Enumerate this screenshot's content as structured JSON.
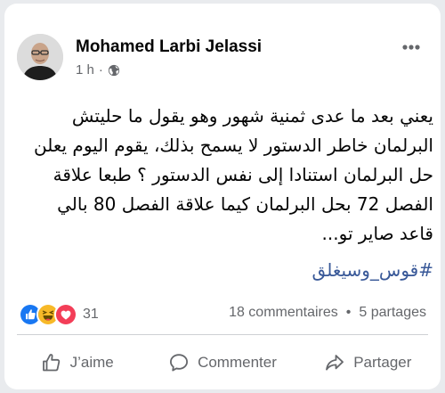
{
  "post": {
    "author": "Mohamed Larbi Jelassi",
    "time": "1 h",
    "separator": "·",
    "privacy_icon": "globe-icon",
    "lines": [
      "يعني بعد ما عدى ثمنية شهور وهو يقول ما حليتش",
      "البرلمان خاطر الدستور لا يسمح بذلك، يقوم اليوم يعلن",
      "حل البرلمان استنادا إلى نفس الدستور ؟ طبعا علاقة",
      "الفصل 72 بحل البرلمان كيما علاقة الفصل 80 بالي",
      "قاعد صاير تو..."
    ],
    "hashtag": "#قوس_وسيغلق"
  },
  "reactions": {
    "icons": [
      "like-icon",
      "haha-icon",
      "love-icon"
    ],
    "count": "31",
    "comments": "18 commentaires",
    "dot": "•",
    "shares": "5 partages"
  },
  "actions": {
    "like": "J’aime",
    "comment": "Commenter",
    "share": "Partager"
  },
  "colors": {
    "link": "#385898",
    "secondary_text": "#65676b",
    "like_blue": "#1877f2",
    "haha_yellow": "#f7b928",
    "love_red": "#f33e58"
  }
}
